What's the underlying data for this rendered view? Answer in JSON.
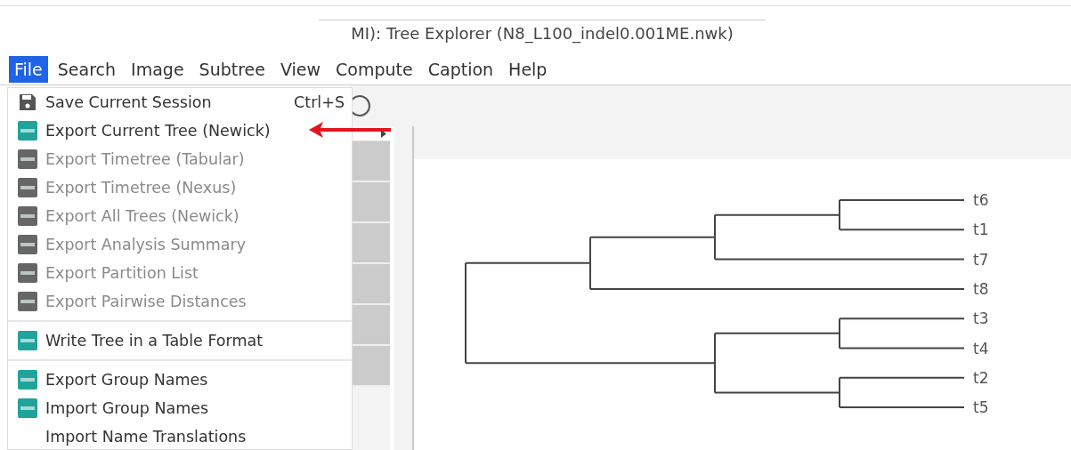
{
  "window": {
    "title": "MI): Tree Explorer (N8_L100_indel0.001ME.nwk)"
  },
  "menu_bar": [
    {
      "label": "File",
      "selected": true
    },
    {
      "label": "Search",
      "selected": false
    },
    {
      "label": "Image",
      "selected": false
    },
    {
      "label": "Subtree",
      "selected": false
    },
    {
      "label": "View",
      "selected": false
    },
    {
      "label": "Compute",
      "selected": false
    },
    {
      "label": "Caption",
      "selected": false
    },
    {
      "label": "Help",
      "selected": false
    }
  ],
  "file_menu": [
    {
      "kind": "save",
      "label": "Save Current Session",
      "shortcut": "Ctrl+S",
      "disabled": false
    },
    {
      "kind": "tool",
      "label": "Export Current Tree (Newick)",
      "disabled": false,
      "pointed_at": true
    },
    {
      "kind": "tool",
      "label": "Export Timetree (Tabular)",
      "disabled": true
    },
    {
      "kind": "tool",
      "label": "Export Timetree (Nexus)",
      "disabled": true
    },
    {
      "kind": "tool",
      "label": "Export All Trees (Newick)",
      "disabled": true
    },
    {
      "kind": "tool",
      "label": "Export Analysis Summary",
      "disabled": true
    },
    {
      "kind": "tool",
      "label": "Export Partition List",
      "disabled": true
    },
    {
      "kind": "tool",
      "label": "Export Pairwise Distances",
      "disabled": true
    },
    {
      "kind": "separator"
    },
    {
      "kind": "tool",
      "label": "Write Tree in a Table Format",
      "disabled": false
    },
    {
      "kind": "separator"
    },
    {
      "kind": "tool",
      "label": "Export Group Names",
      "disabled": false
    },
    {
      "kind": "tool",
      "label": "Import Group Names",
      "disabled": false
    },
    {
      "kind": "plain",
      "label": "Import Name Translations",
      "disabled": false
    }
  ],
  "tree": {
    "children": [
      {
        "children": [
          {
            "children": [
              {
                "children": [
                  {
                    "label": "t6"
                  },
                  {
                    "label": "t1"
                  }
                ]
              },
              {
                "label": "t7"
              }
            ]
          },
          {
            "label": "t8"
          }
        ]
      },
      {
        "children": [
          {
            "children": [
              {
                "label": "t3"
              },
              {
                "label": "t4"
              }
            ]
          },
          {
            "children": [
              {
                "label": "t2"
              },
              {
                "label": "t5"
              }
            ]
          }
        ]
      }
    ]
  }
}
